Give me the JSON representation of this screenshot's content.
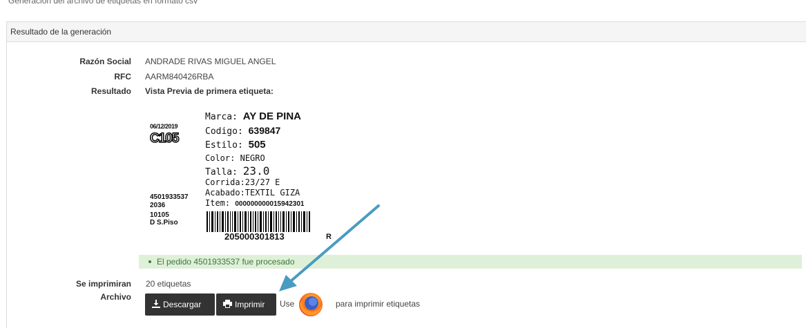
{
  "top_section": {
    "text": "Generación del archivo de etiquetas en formato csv"
  },
  "panel": {
    "title": "Resultado de la generación"
  },
  "fields": {
    "razon_social_label": "Razón Social",
    "razon_social_value": "ANDRADE RIVAS MIGUEL ANGEL",
    "rfc_label": "RFC",
    "rfc_value": "AARM840426RBA",
    "resultado_label": "Resultado",
    "resultado_value": "Vista Previa de primera etiqueta:"
  },
  "label_preview": {
    "date": "06/12/2019",
    "code": "C105",
    "marca_key": "Marca:",
    "marca_val": "AY DE PINA",
    "codigo_key": "Codigo:",
    "codigo_val": "639847",
    "estilo_key": "Estilo:",
    "estilo_val": "505",
    "color_key": "Color:",
    "color_val": "NEGRO",
    "talla_key": "Talla:",
    "talla_val": "23.0",
    "corrida": "Corrida:23/27 E",
    "acabado": "Acabado:TEXTIL GIZA",
    "item_key": "Item:",
    "item_val": "000000000015942301",
    "side_1": "4501933537",
    "side_2": "2036",
    "side_3": "10105",
    "side_4": "D S.Piso",
    "barcode_number": "205000301813",
    "r_mark": "R"
  },
  "alert": {
    "message": "El pedido 4501933537 fue procesado"
  },
  "print_info": {
    "se_imprimiran_label": "Se imprimiran",
    "se_imprimiran_value": "20 etiquetas",
    "archivo_label": "Archivo"
  },
  "buttons": {
    "download_label": "Descargar",
    "print_label": "Imprimir"
  },
  "hint": {
    "use": "Use",
    "suffix": "para imprimir etiquetas"
  },
  "colors": {
    "arrow": "#4a9bc1",
    "alert_bg": "#dff0d8",
    "button_bg": "#333333"
  },
  "icons": {
    "download": "download-icon",
    "print": "print-icon",
    "browser": "firefox-icon"
  }
}
